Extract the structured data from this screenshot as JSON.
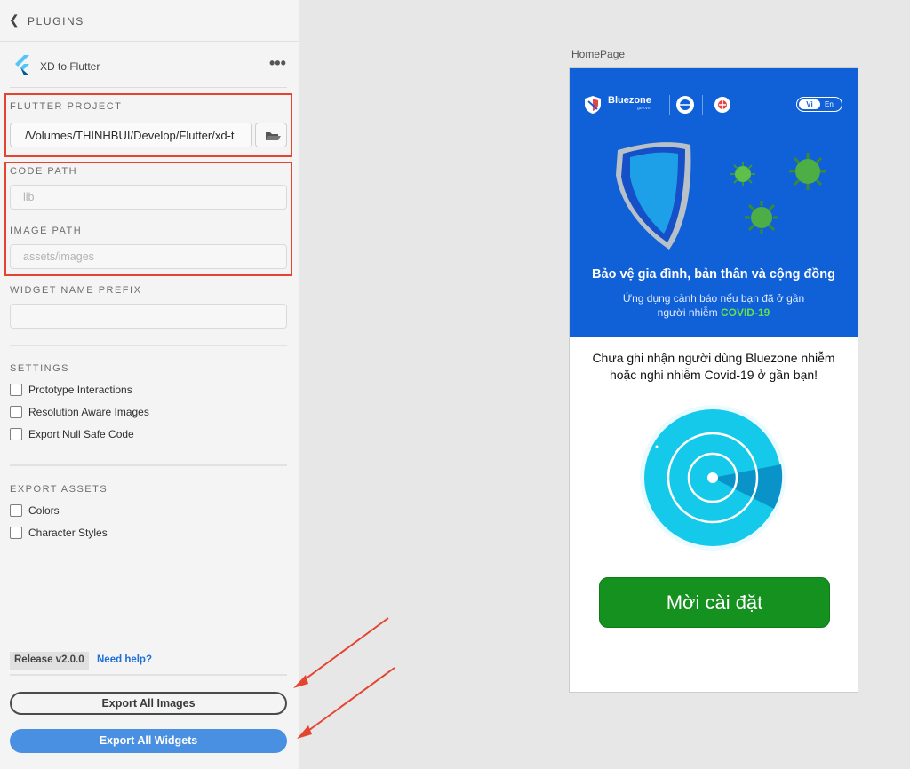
{
  "header": {
    "back_icon": "chevron-left-icon",
    "title": "PLUGINS"
  },
  "plugin": {
    "name": "XD to Flutter",
    "logo_icon": "flutter-logo-icon",
    "menu_icon": "more-dots-icon"
  },
  "flutter_project": {
    "label": "FLUTTER PROJECT",
    "value": "/Volumes/THINHBUI/Develop/Flutter/xd-t",
    "folder_icon": "folder-icon"
  },
  "code_path": {
    "label": "CODE PATH",
    "placeholder": "lib"
  },
  "image_path": {
    "label": "IMAGE PATH",
    "placeholder": "assets/images"
  },
  "widget_prefix": {
    "label": "WIDGET NAME PREFIX",
    "value": ""
  },
  "settings": {
    "label": "SETTINGS",
    "items": [
      {
        "label": "Prototype Interactions",
        "checked": false
      },
      {
        "label": "Resolution Aware Images",
        "checked": false
      },
      {
        "label": "Export Null Safe Code",
        "checked": false
      }
    ]
  },
  "export_assets": {
    "label": "EXPORT ASSETS",
    "items": [
      {
        "label": "Colors",
        "checked": false
      },
      {
        "label": "Character Styles",
        "checked": false
      }
    ]
  },
  "footer": {
    "release": "Release v2.0.0",
    "help": "Need help?",
    "export_images": "Export All Images",
    "export_widgets": "Export All Widgets"
  },
  "colors": {
    "accent": "#4a90e2",
    "highlight": "#e4452f",
    "app_blue": "#1060d8",
    "install_green": "#14911f"
  },
  "artboard": {
    "label": "HomePage",
    "brand": "Bluezone",
    "brand_sub": "gov.vn",
    "lang_vi": "Vi",
    "lang_en": "En",
    "headline": "Bảo vệ gia đình, bản thân và cộng đồng",
    "subline1": "Ứng dụng cảnh báo nếu bạn đã ở gần",
    "subline2_prefix": "người nhiễm ",
    "subline2_highlight": "COVID-19",
    "status_line1": "Chưa ghi nhận người dùng Bluezone nhiễm",
    "status_line2": "hoặc nghi nhiễm Covid-19 ở gần bạn!",
    "install_button": "Mời cài đặt"
  }
}
